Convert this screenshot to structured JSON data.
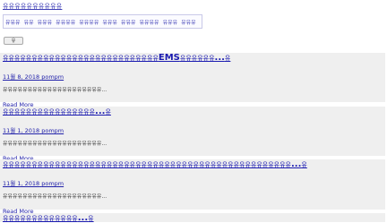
{
  "header": {
    "site_title": "유유유유유유유유유유"
  },
  "nav": {
    "items": [
      "유유유",
      "유유",
      "유유유",
      "유유유유",
      "유유유유",
      "유유유",
      "유유유",
      "유유유유",
      "유유유",
      "유유유"
    ]
  },
  "search": {
    "button_label": "유"
  },
  "posts": [
    {
      "title_prefix": "유유유유유유유유유유유유유유유유유유유유유유유유유유유",
      "title_highlight": "EMS",
      "title_suffix": "유유유유유유",
      "title_ellipsis": "...",
      "title_tail": "유",
      "date": "11월 8, 2018",
      "author": "pompm",
      "excerpt": "유유유유유유유유유유유유유유유유유유유유...",
      "read_more": "Read More"
    },
    {
      "title_prefix": "유유유유유유유유유유유유유유유유",
      "title_highlight": "",
      "title_suffix": "",
      "title_ellipsis": "...",
      "title_tail": "유",
      "date": "11월 1, 2018",
      "author": "pompm",
      "excerpt": "유유유유유유유유유유유유유유유유유유유유...",
      "read_more": "Read More"
    },
    {
      "title_prefix": "유유유유유유유유유유유유유유유유유유유유유유유유유유유유유유유유유유유유유유유유유유유유유유유유유유",
      "title_highlight": "",
      "title_suffix": "",
      "title_ellipsis": "...",
      "title_tail": "유",
      "date": "11월 1, 2018",
      "author": "pompm",
      "excerpt": "유유유유유유유유유유유유유유유유유유유유...",
      "read_more": "Read More"
    },
    {
      "title_prefix": "유유유유유유유유유유유유유",
      "title_highlight": "",
      "title_suffix": "",
      "title_ellipsis": "...",
      "title_tail": "유",
      "date": "",
      "author": "",
      "excerpt": "",
      "read_more": ""
    }
  ]
}
